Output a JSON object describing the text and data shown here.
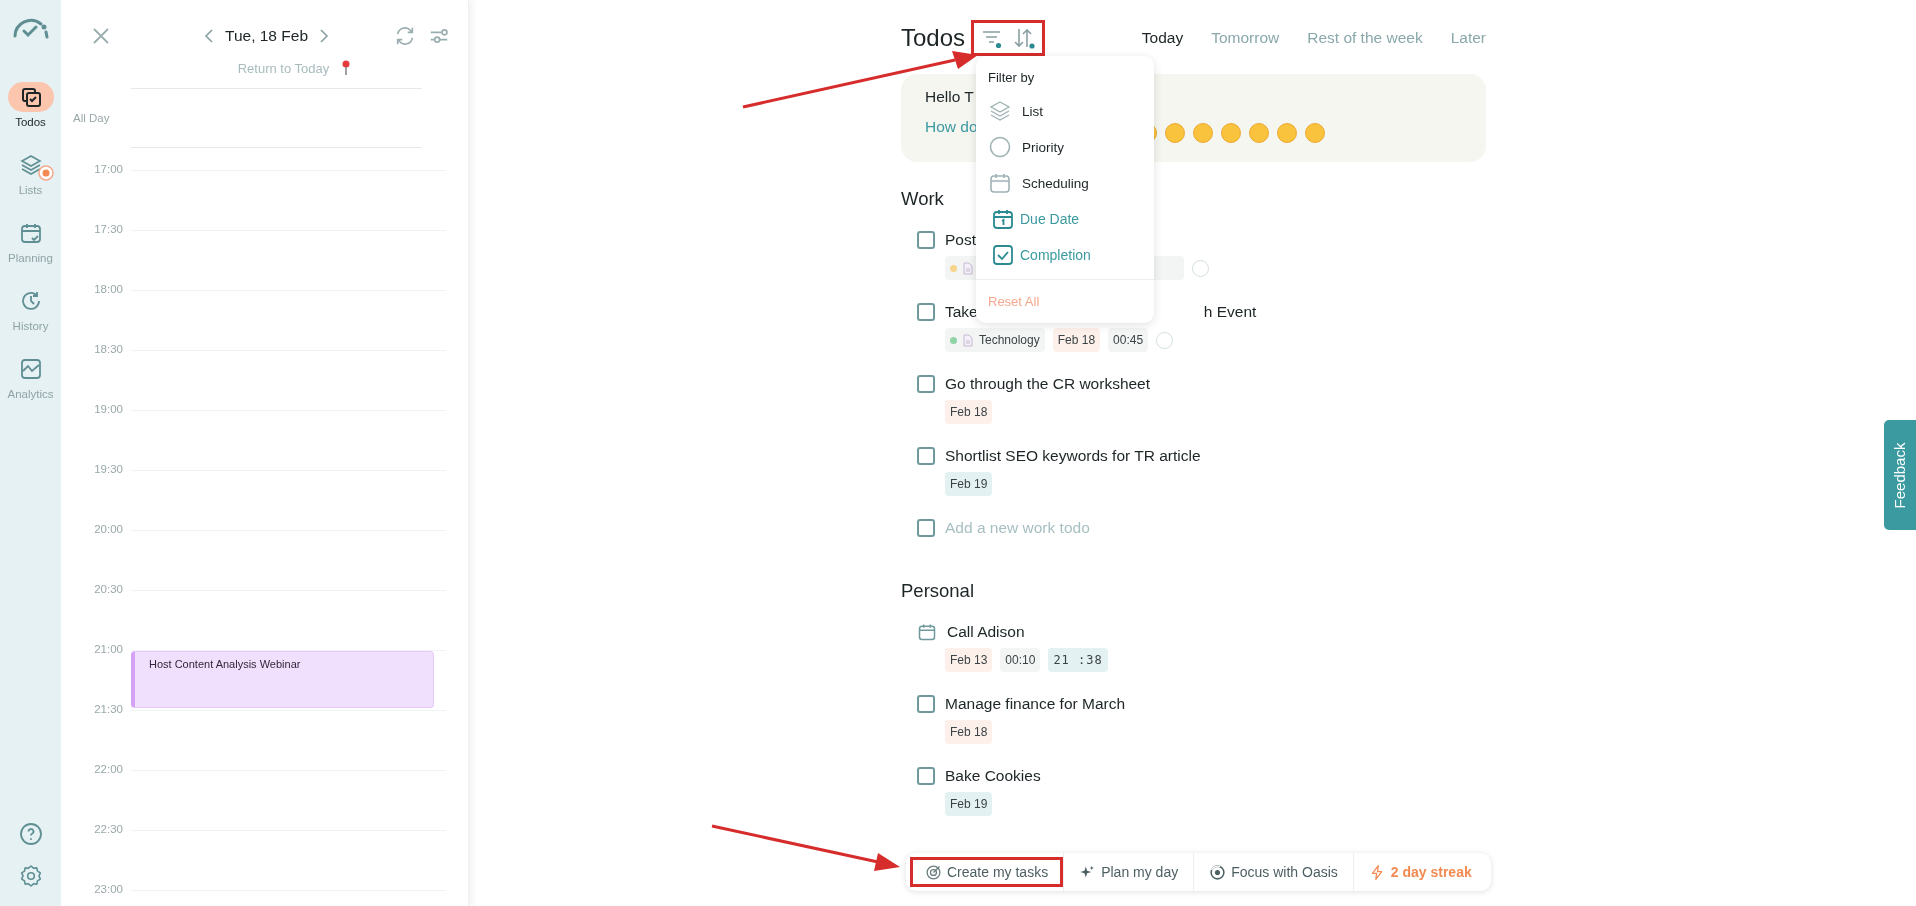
{
  "nav": {
    "items": [
      {
        "label": "Todos",
        "kind": "todos",
        "selected": true
      },
      {
        "label": "Lists",
        "kind": "lists",
        "selected": false
      },
      {
        "label": "Planning",
        "kind": "planning",
        "selected": false
      },
      {
        "label": "History",
        "kind": "history",
        "selected": false
      },
      {
        "label": "Analytics",
        "kind": "analytics",
        "selected": false
      }
    ]
  },
  "calendar": {
    "date": "Tue, 18 Feb",
    "return_label": "Return to Today",
    "all_day_label": "All Day",
    "slots": [
      {
        "time": "17:00"
      },
      {
        "time": "17:30"
      },
      {
        "time": "18:00"
      },
      {
        "time": "18:30"
      },
      {
        "time": "19:00"
      },
      {
        "time": "19:30"
      },
      {
        "time": "20:00"
      },
      {
        "time": "20:30"
      },
      {
        "time": "21:00",
        "event": "Host Content Analysis Webinar"
      },
      {
        "time": "21:30"
      },
      {
        "time": "22:00"
      },
      {
        "time": "22:30"
      },
      {
        "time": "23:00"
      }
    ]
  },
  "todos": {
    "title": "Todos",
    "icons_annotated": true,
    "tabs": [
      {
        "label": "Today",
        "selected": true
      },
      {
        "label": "Tomorrow",
        "selected": false
      },
      {
        "label": "Rest of the week",
        "selected": false
      },
      {
        "label": "Later",
        "selected": false
      }
    ],
    "greeting": {
      "hello": "Hello T",
      "question": "How do"
    },
    "filter_menu": {
      "title": "Filter by",
      "reset": "Reset All",
      "items": [
        {
          "label": "List",
          "kind": "list",
          "active": false
        },
        {
          "label": "Priority",
          "kind": "priority",
          "active": false
        },
        {
          "label": "Scheduling",
          "kind": "scheduling",
          "active": false
        },
        {
          "label": "Due Date",
          "kind": "due",
          "active": true
        },
        {
          "label": "Completion",
          "kind": "completion",
          "active": true
        }
      ]
    },
    "sections": [
      {
        "title": "Work",
        "add_row": {
          "placeholder": "Add a new work todo",
          "checked": false
        },
        "items": [
          {
            "kind": "task",
            "checked": false,
            "title": "Post",
            "tags": [
              {
                "kind": "list",
                "color": "#f8d58c"
              },
              {
                "kind": "priority"
              }
            ]
          },
          {
            "kind": "task",
            "checked": false,
            "title": "Take",
            "title_tail": "h Event",
            "tags": [
              {
                "kind": "list",
                "label": "Technology",
                "color": "#8fd3a7"
              },
              {
                "kind": "date",
                "label": "Feb 18",
                "color": "#fdefe9"
              },
              {
                "kind": "duration",
                "label": "00:45"
              },
              {
                "kind": "priority"
              }
            ]
          },
          {
            "kind": "task",
            "checked": false,
            "title": "Go through the CR worksheet",
            "tags": [
              {
                "kind": "date",
                "label": "Feb 18",
                "color": "#fdefe9"
              }
            ]
          },
          {
            "kind": "task",
            "checked": false,
            "title": "Shortlist SEO keywords for TR article",
            "tags": [
              {
                "kind": "date",
                "label": "Feb 19",
                "color": "#e4f1f2"
              }
            ]
          }
        ]
      },
      {
        "title": "Personal",
        "items": [
          {
            "kind": "event",
            "title": "Call Adison",
            "tags": [
              {
                "kind": "date",
                "label": "Feb 13",
                "color": "#fdefe9"
              },
              {
                "kind": "duration",
                "label": "00:10"
              },
              {
                "kind": "timer",
                "label": "21 :38"
              }
            ]
          },
          {
            "kind": "task",
            "checked": false,
            "title": "Manage finance for March",
            "tags": [
              {
                "kind": "date",
                "label": "Feb 18",
                "color": "#fdefe9"
              }
            ]
          },
          {
            "kind": "task",
            "checked": false,
            "title": "Bake Cookies",
            "tags": [
              {
                "kind": "date",
                "label": "Feb 19",
                "color": "#e4f1f2"
              }
            ]
          }
        ]
      }
    ]
  },
  "action_bar": [
    {
      "label": "Create my tasks",
      "kind": "create",
      "annotated": true
    },
    {
      "label": "Plan my day",
      "kind": "plan",
      "annotated": false
    },
    {
      "label": "Focus with Oasis",
      "kind": "focus",
      "annotated": false
    },
    {
      "label": "2 day streak",
      "kind": "streak",
      "annotated": false
    }
  ],
  "feedback": {
    "label": "Feedback"
  }
}
